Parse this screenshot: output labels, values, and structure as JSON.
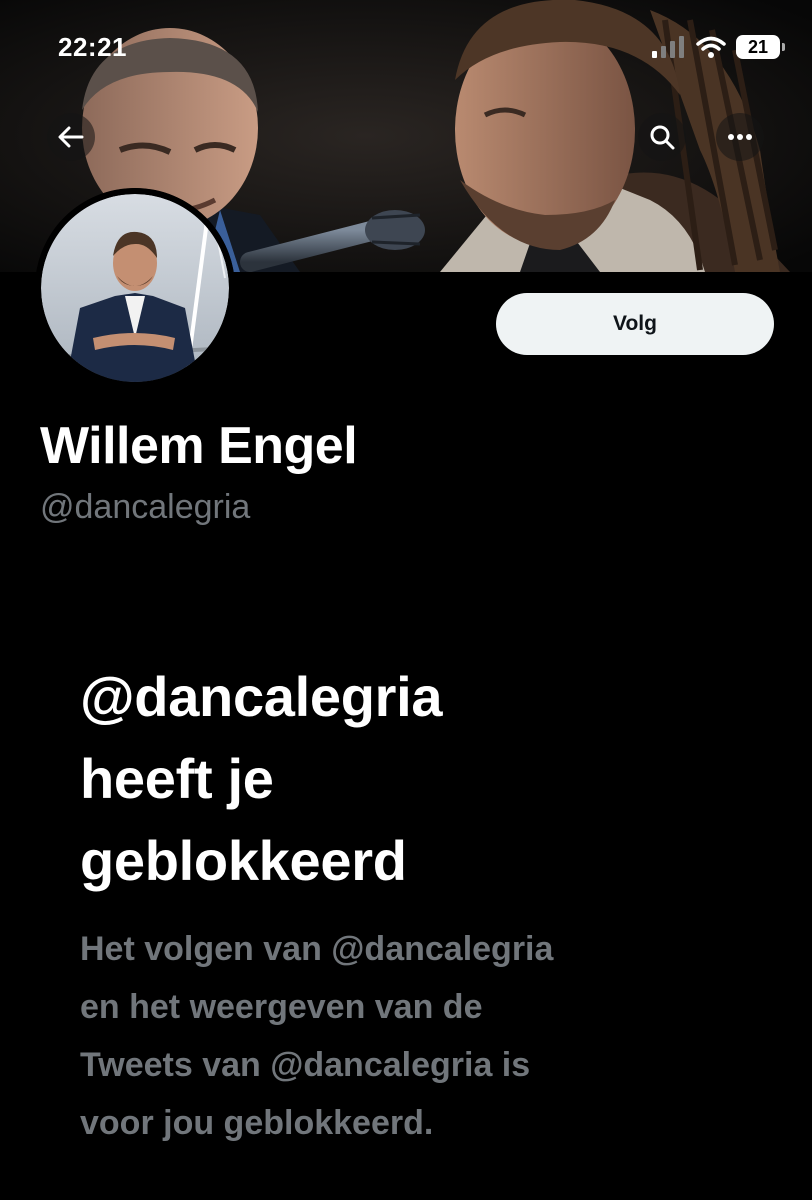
{
  "status_bar": {
    "time": "22:21",
    "battery_level": "21",
    "icons": [
      "signal-icon",
      "wifi-icon",
      "battery-icon"
    ]
  },
  "header": {
    "back_icon": "arrow-left-icon",
    "search_icon": "search-icon",
    "more_icon": "more-horizontal-icon"
  },
  "profile": {
    "display_name": "Willem Engel",
    "handle": "@dancalegria",
    "follow_label": "Volg"
  },
  "blocked_notice": {
    "heading_lines": [
      "@dancalegria",
      "heeft je",
      "geblokkeerd"
    ],
    "description_lines": [
      "Het volgen van @dancalegria",
      "en het weergeven van de",
      "Tweets van @dancalegria is",
      "voor jou geblokkeerd."
    ]
  },
  "colors": {
    "background": "#000000",
    "primary_text": "#ffffff",
    "secondary_text": "#71767b",
    "follow_button_bg": "#eff3f4",
    "follow_button_text": "#0f1419"
  }
}
